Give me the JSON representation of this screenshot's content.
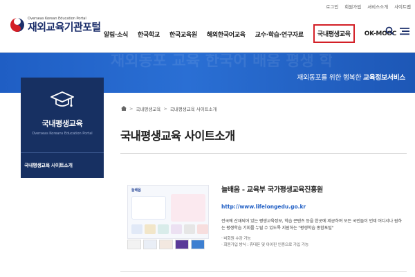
{
  "utility": {
    "items": [
      "로그인",
      "회원가입",
      "서비스소개",
      "사이트맵"
    ]
  },
  "logo": {
    "subtitle": "Overseas Korean Education Portal",
    "title": "재외교육기관포털"
  },
  "nav": {
    "items": [
      {
        "label": "알림·소식"
      },
      {
        "label": "한국학교"
      },
      {
        "label": "한국교육원"
      },
      {
        "label": "해외한국어교육"
      },
      {
        "label": "교수·학습·연구자료"
      },
      {
        "label": "국내평생교육",
        "highlighted": true
      },
      {
        "label": "OK-MOOC"
      }
    ]
  },
  "icons": {
    "search": "search-icon",
    "menu": "hamburger-menu-icon",
    "home": "home-icon",
    "graduation": "graduation-cap-icon"
  },
  "banner": {
    "text_plain": "재외동포를 위한 행복한 ",
    "text_bold": "교육정보서비스",
    "pattern_text": "재외동포 교육 한국어 배움 평생 학습 교육정보 한국학교 교육원"
  },
  "sidebar": {
    "title": "국내평생교육",
    "subtitle": "Overseas Koreans Education Portal",
    "menu_item": "국내평생교육 사이트소개"
  },
  "breadcrumb": {
    "items": [
      "국내평생교육",
      "국내평생교육 사이트소개"
    ]
  },
  "page": {
    "title": "국내평생교육 사이트소개"
  },
  "card": {
    "thumb_logo": "늘배움",
    "site_name": "늘배움 - 교육부 국가평생교육진흥원",
    "url": "http://www.lifelongedu.go.kr",
    "description": "전국에 산재되어 있는 평생교육정보, 학습 콘텐츠 등을 한곳에 제공하여 모든 국민들이 언제 어디서나 원하는 평생학습 기회를 누릴 수 있도록 지원하는 \"평생학습 종합포털\"",
    "notes": [
      "· 비회원 수강 가능",
      "· 회원가입 방식 : 휴대폰 및 아이핀 인증으로 가입 가능"
    ]
  },
  "colors": {
    "navy": "#173062",
    "banner_blue": "#1f5ec4",
    "highlight_red": "#d31f26",
    "logo_navy": "#1c2f6b"
  }
}
